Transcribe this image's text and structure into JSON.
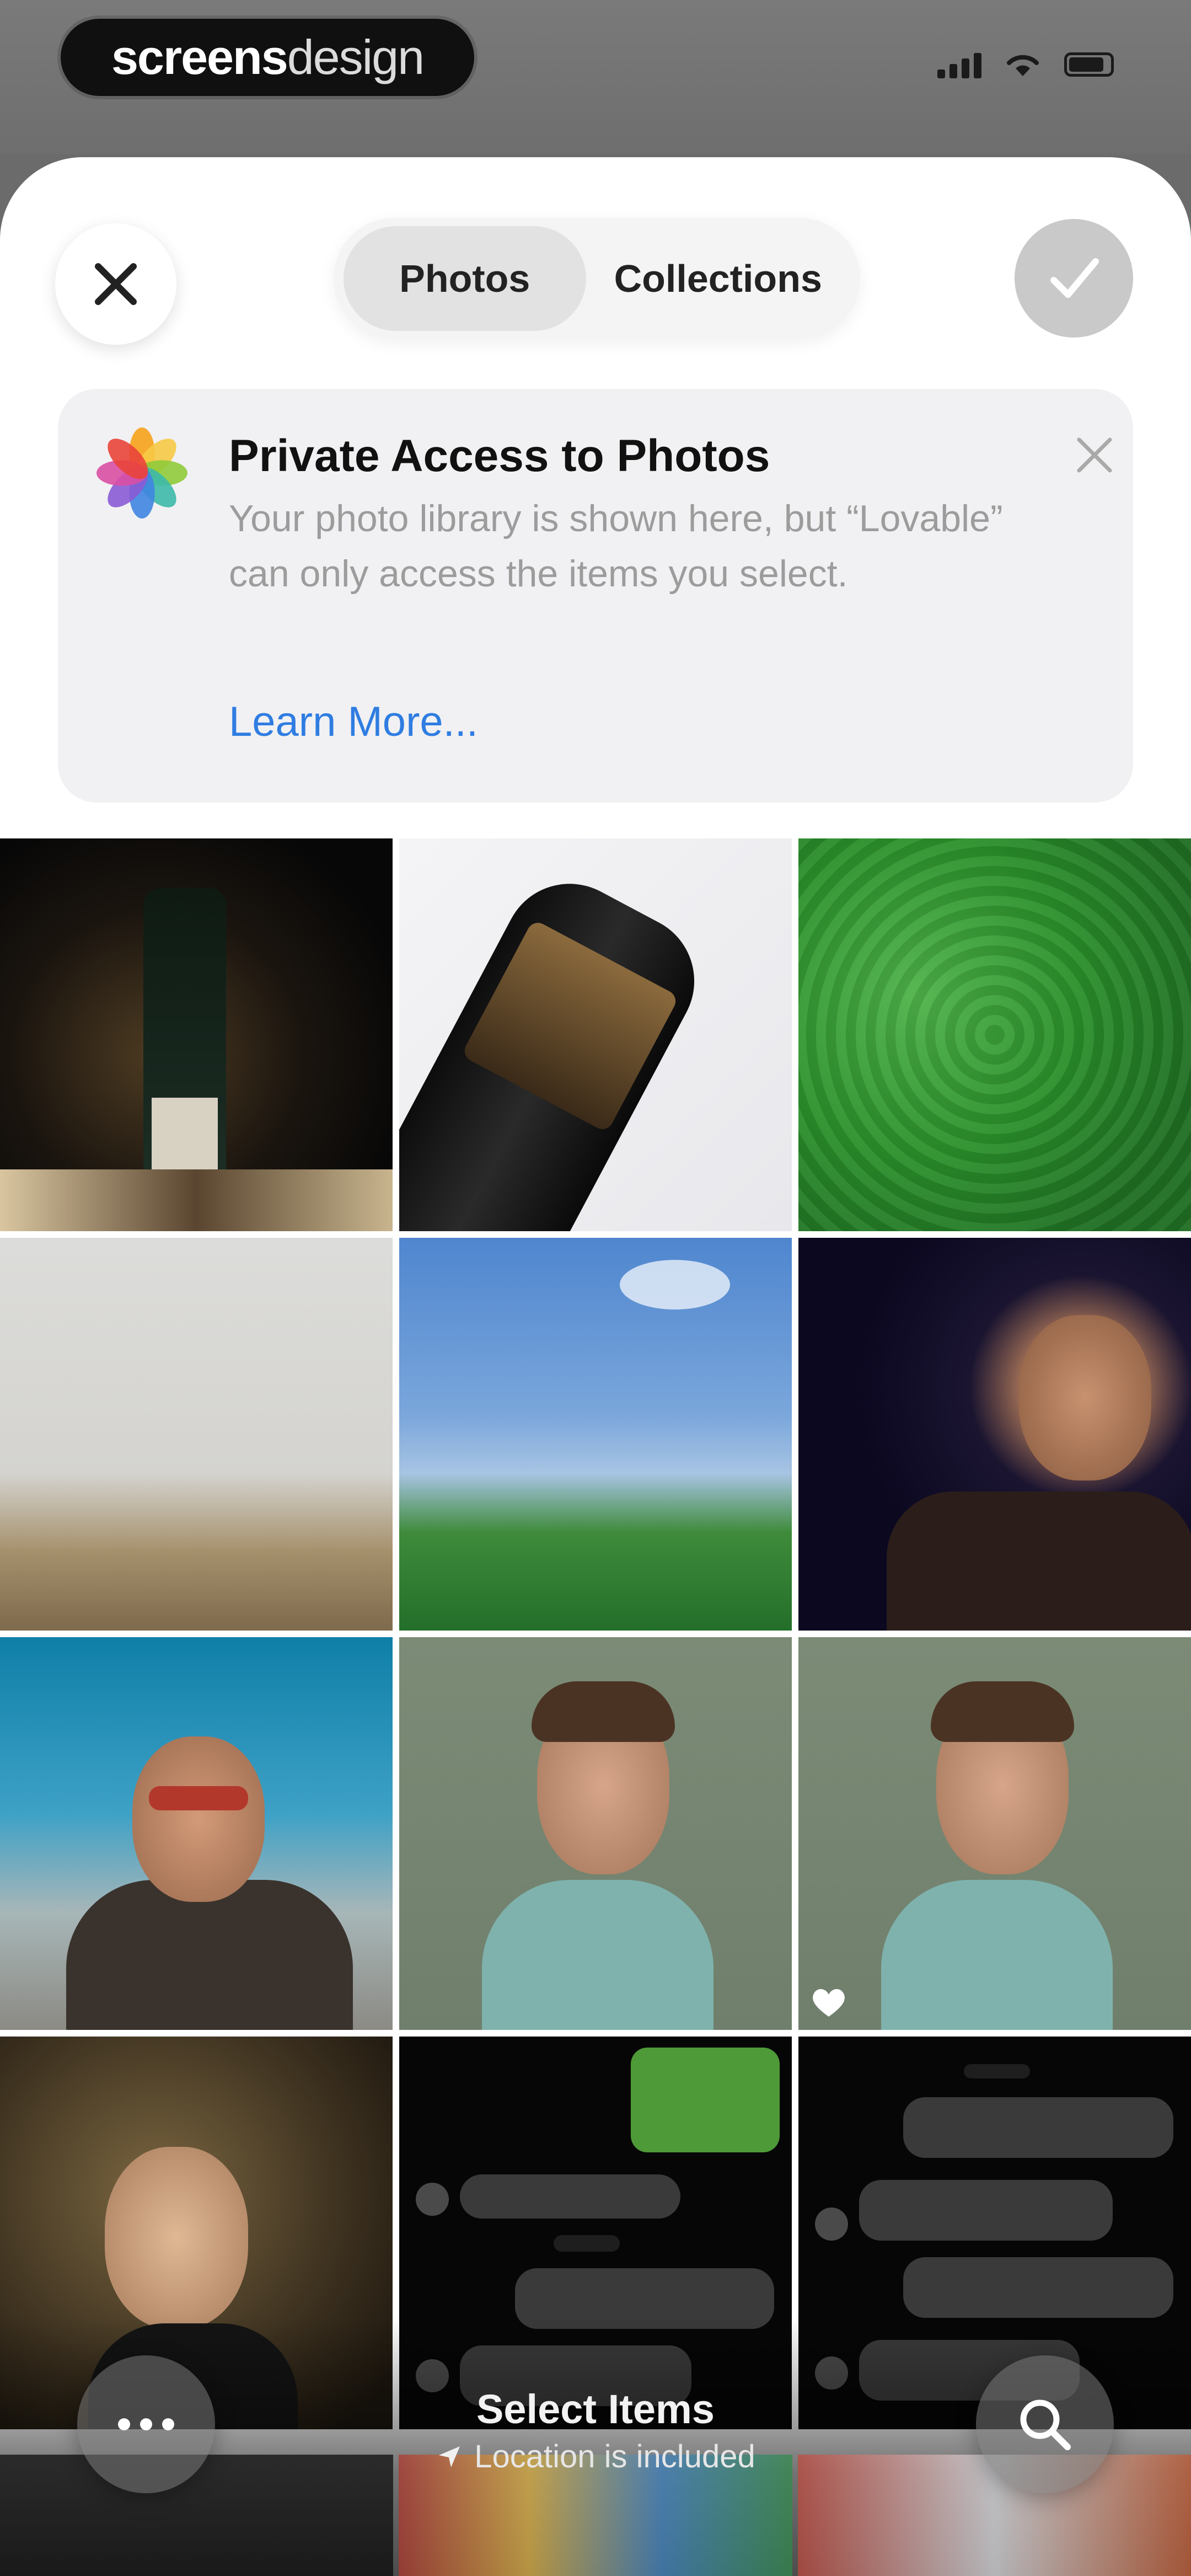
{
  "status": {
    "brand_bold": "screens",
    "brand_light": "design"
  },
  "header": {
    "tabs": [
      {
        "label": "Photos",
        "active": true
      },
      {
        "label": "Collections",
        "active": false
      }
    ]
  },
  "privacy_card": {
    "title": "Private Access to Photos",
    "body": "Your photo library is shown here, but “Lovable” can only access the items you select.",
    "link": "Learn More..."
  },
  "bottom": {
    "title": "Select Items",
    "subtitle": "Location is included"
  },
  "colors": {
    "accent_link": "#2f7de1",
    "done_button": "#c9c9c9"
  },
  "icons": [
    "close-icon",
    "checkmark-icon",
    "photos-app-icon",
    "dismiss-icon",
    "heart-icon",
    "more-icon",
    "search-icon",
    "location-arrow-icon"
  ]
}
